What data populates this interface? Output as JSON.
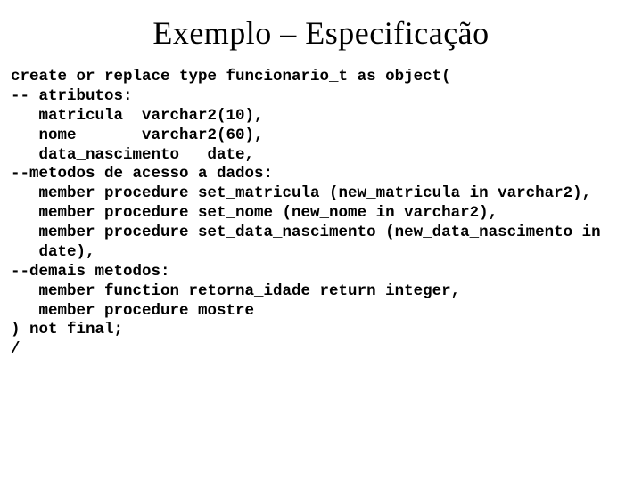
{
  "title": "Exemplo – Especificação",
  "code": {
    "l01": "create or replace type funcionario_t as object(",
    "l02": "-- atributos:",
    "l03": "   matricula  varchar2(10),",
    "l04": "   nome       varchar2(60),",
    "l05": "   data_nascimento   date,",
    "l06": "--metodos de acesso a dados:",
    "l07": "   member procedure set_matricula (new_matricula in varchar2),",
    "l08": "   member procedure set_nome (new_nome in varchar2),",
    "l09": "   member procedure set_data_nascimento (new_data_nascimento in",
    "l10": "   date),",
    "l11": "--demais metodos:",
    "l12": "   member function retorna_idade return integer,",
    "l13": "   member procedure mostre",
    "l14": ") not final;",
    "l15": "/"
  }
}
